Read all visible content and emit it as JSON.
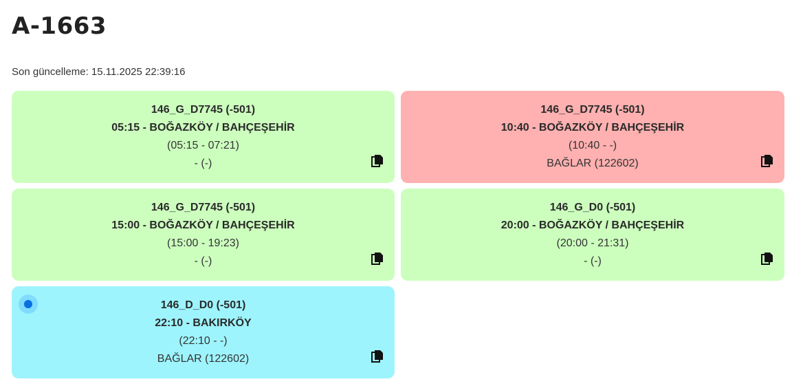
{
  "header": {
    "title": "A-1663",
    "updated_label": "Son güncelleme: 15.11.2025 22:39:16"
  },
  "colors": {
    "green": "#ccffbe",
    "red": "#ffb0b0",
    "cyan": "#9ef4fd",
    "active_dot": "#0a6fe0"
  },
  "cards": [
    {
      "status": "green",
      "line1": "146_G_D7745 (-501)",
      "line2": "05:15 - BOĞAZKÖY / BAHÇEŞEHİR",
      "line3": "(05:15 - 07:21)",
      "line4": "- (-)",
      "icon": "copy-icon"
    },
    {
      "status": "red",
      "line1": "146_G_D7745 (-501)",
      "line2": "10:40 - BOĞAZKÖY / BAHÇEŞEHİR",
      "line3": "(10:40 - -)",
      "line4": "BAĞLAR (122602)",
      "icon": "copy-icon"
    },
    {
      "status": "green",
      "line1": "146_G_D7745 (-501)",
      "line2": "15:00 - BOĞAZKÖY / BAHÇEŞEHİR",
      "line3": "(15:00 - 19:23)",
      "line4": "- (-)",
      "icon": "copy-icon"
    },
    {
      "status": "green",
      "line1": "146_G_D0 (-501)",
      "line2": "20:00 - BOĞAZKÖY / BAHÇEŞEHİR",
      "line3": "(20:00 - 21:31)",
      "line4": "- (-)",
      "icon": "copy-icon"
    },
    {
      "status": "cyan",
      "active": true,
      "line1": "146_D_D0 (-501)",
      "line2": "22:10 - BAKIRKÖY",
      "line3": "(22:10 - -)",
      "line4": "BAĞLAR (122602)",
      "icon": "copy-icon"
    }
  ]
}
